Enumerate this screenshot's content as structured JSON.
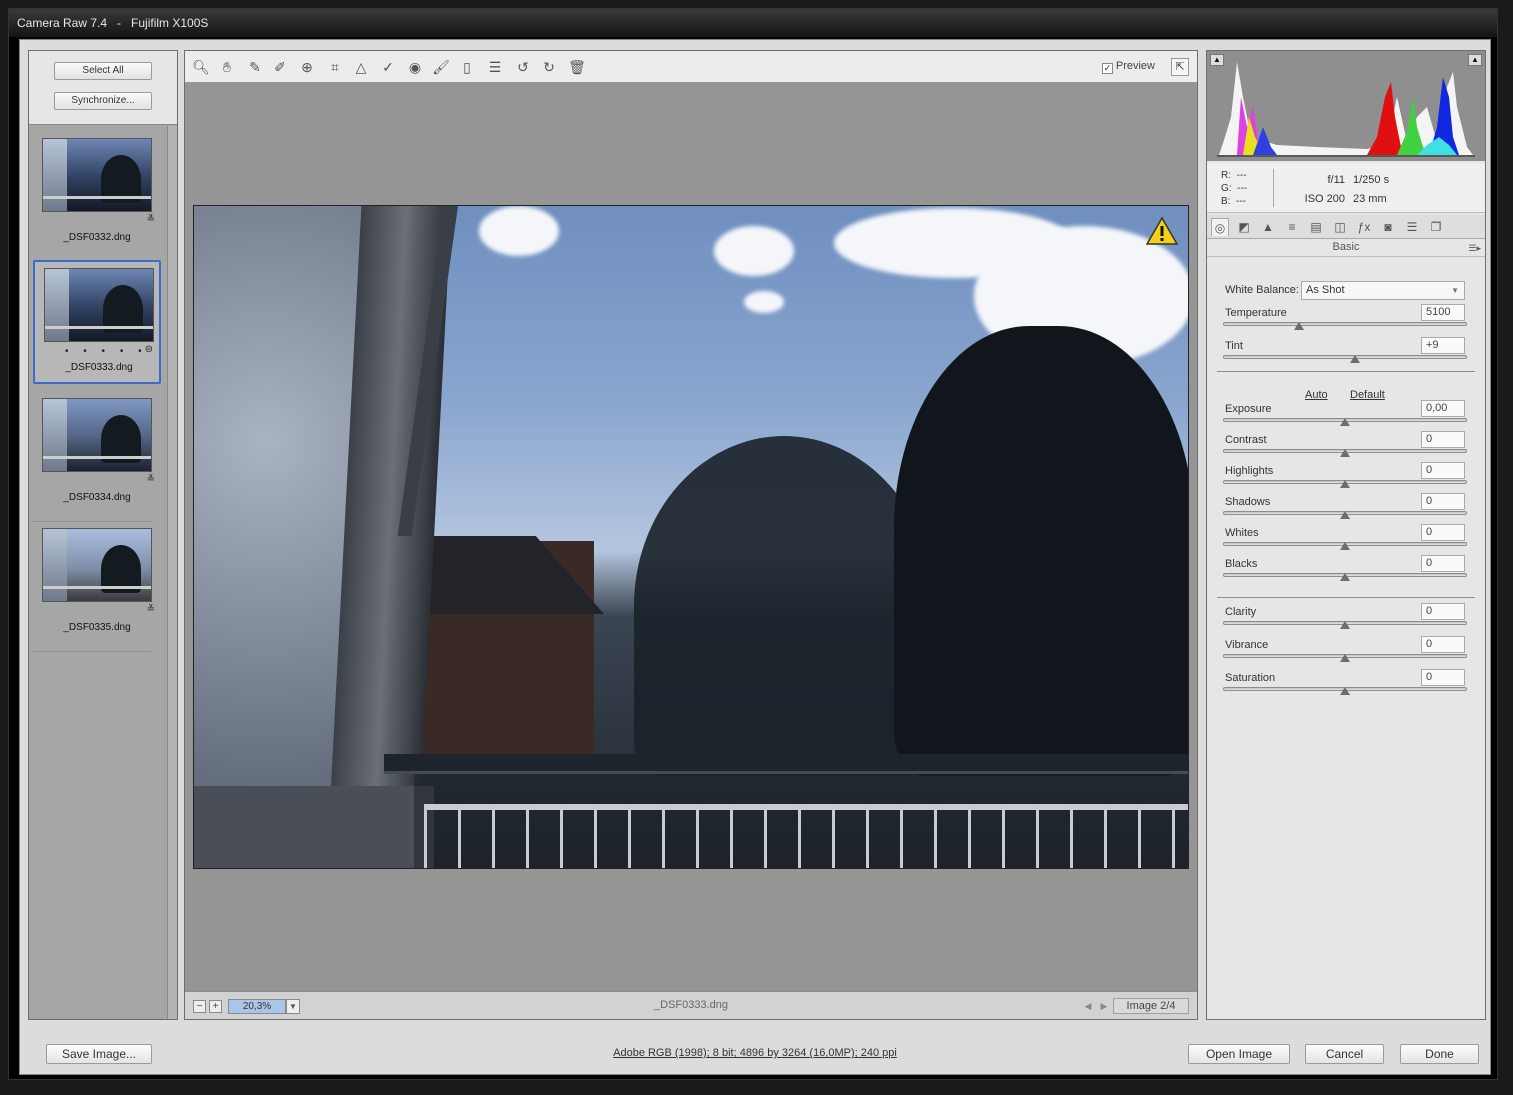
{
  "window": {
    "title": "Camera Raw 7.4",
    "camera": "Fujifilm X100S"
  },
  "filmstrip": {
    "select_all": "Select All",
    "synchronize": "Synchronize...",
    "items": [
      {
        "name": "_DSF0332.dng"
      },
      {
        "name": "_DSF0333.dng",
        "selected": true,
        "rating": "• • • • •"
      },
      {
        "name": "_DSF0334.dng"
      },
      {
        "name": "_DSF0335.dng"
      }
    ]
  },
  "toolbar": {
    "tools": [
      "zoom-tool",
      "hand-tool",
      "white-balance-tool",
      "color-sampler-tool",
      "targeted-adjustment-tool",
      "crop-tool",
      "straighten-tool",
      "spot-removal-tool",
      "red-eye-tool",
      "adjustment-brush",
      "graduated-filter",
      "preferences",
      "rotate-ccw",
      "rotate-cw",
      "trash"
    ],
    "preview_label": "Preview",
    "preview_checked": true
  },
  "status": {
    "zoom": "20,3%",
    "filename": "_DSF0333.dng",
    "image_count": "Image 2/4"
  },
  "readout": {
    "r_label": "R:",
    "r_value": "---",
    "g_label": "G:",
    "g_value": "---",
    "b_label": "B:",
    "b_value": "---",
    "aperture": "f/11",
    "shutter": "1/250 s",
    "iso": "ISO 200",
    "focal": "23 mm"
  },
  "panel": {
    "title": "Basic",
    "white_balance_label": "White Balance:",
    "white_balance_value": "As Shot",
    "auto": "Auto",
    "default": "Default",
    "sliders": [
      {
        "label": "Temperature",
        "value": "5100",
        "pos": 0.31
      },
      {
        "label": "Tint",
        "value": "+9",
        "pos": 0.54
      },
      {
        "label": "Exposure",
        "value": "0,00",
        "pos": 0.5
      },
      {
        "label": "Contrast",
        "value": "0",
        "pos": 0.5
      },
      {
        "label": "Highlights",
        "value": "0",
        "pos": 0.5
      },
      {
        "label": "Shadows",
        "value": "0",
        "pos": 0.5
      },
      {
        "label": "Whites",
        "value": "0",
        "pos": 0.5
      },
      {
        "label": "Blacks",
        "value": "0",
        "pos": 0.5
      },
      {
        "label": "Clarity",
        "value": "0",
        "pos": 0.5
      },
      {
        "label": "Vibrance",
        "value": "0",
        "pos": 0.5
      },
      {
        "label": "Saturation",
        "value": "0",
        "pos": 0.5
      }
    ]
  },
  "footer": {
    "save": "Save Image...",
    "workflow": "Adobe RGB (1998); 8 bit; 4896 by 3264 (16,0MP); 240 ppi",
    "open": "Open Image",
    "cancel": "Cancel",
    "done": "Done"
  },
  "colors": {
    "accent": "#3b6cc9",
    "zoom_highlight": "#a9c6ea"
  }
}
